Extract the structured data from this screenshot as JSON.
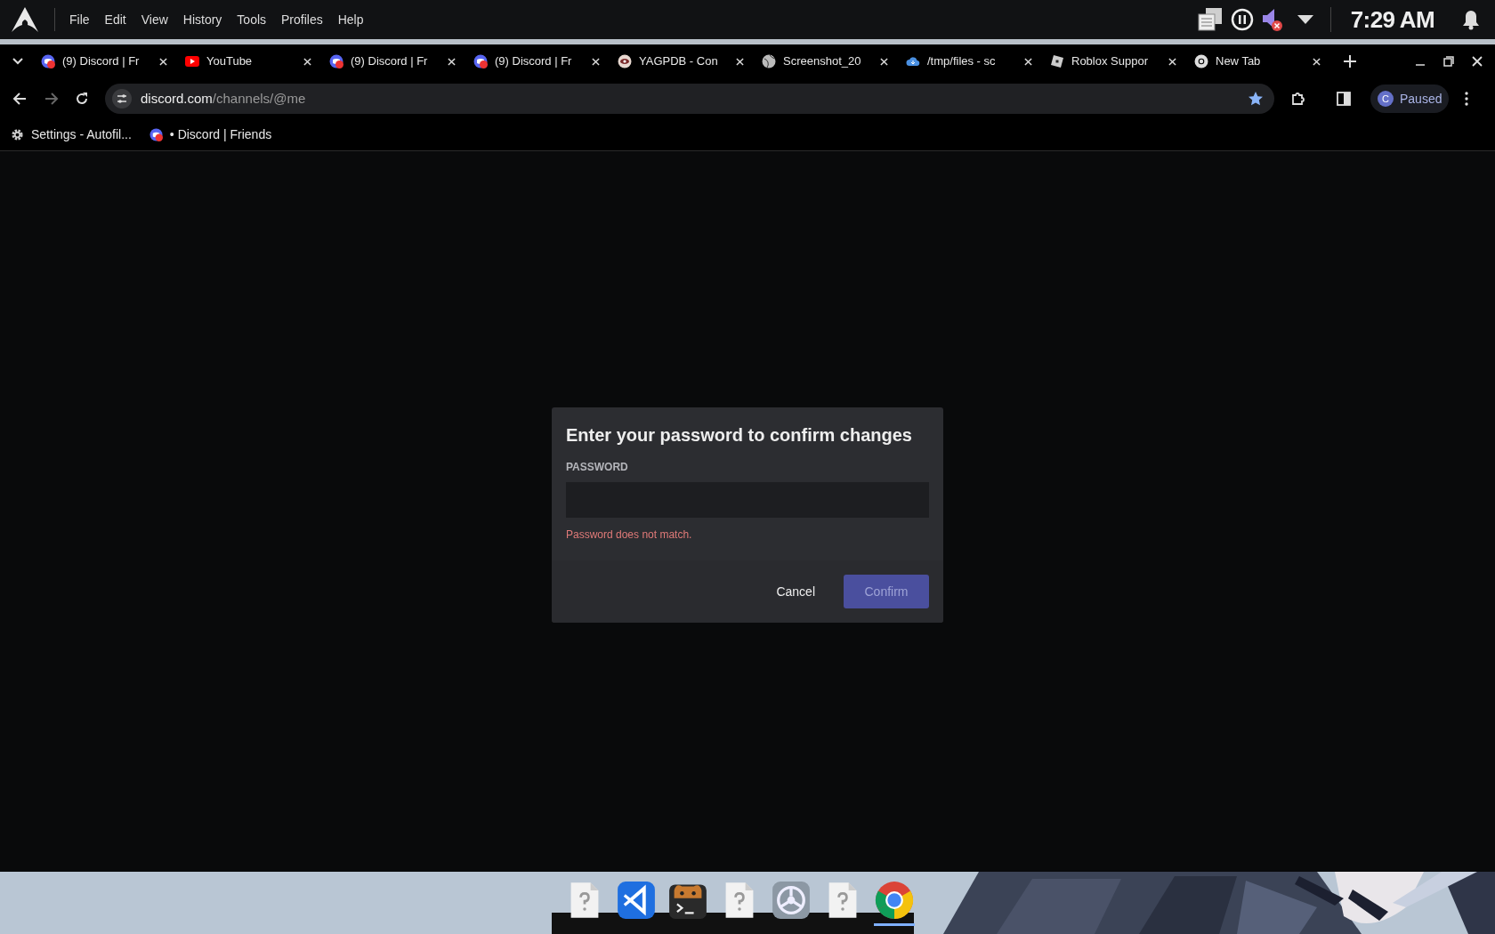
{
  "top_bar": {
    "menus": [
      "File",
      "Edit",
      "View",
      "History",
      "Tools",
      "Profiles",
      "Help"
    ],
    "clock": "7:29 AM"
  },
  "tabs": [
    {
      "title": "(9) Discord | Fr",
      "kind": "discord"
    },
    {
      "title": "YouTube",
      "kind": "youtube"
    },
    {
      "title": "(9) Discord | Fr",
      "kind": "discord"
    },
    {
      "title": "(9) Discord | Fr",
      "kind": "discord"
    },
    {
      "title": "YAGPDB - Con",
      "kind": "eye"
    },
    {
      "title": "Screenshot_20",
      "kind": "globe"
    },
    {
      "title": "/tmp/files - sc",
      "kind": "cloud"
    },
    {
      "title": "Roblox Suppor",
      "kind": "square"
    },
    {
      "title": "New Tab",
      "kind": "chrome"
    }
  ],
  "address_bar": {
    "domain": "discord.com",
    "path": "/channels/@me"
  },
  "profile": {
    "initial": "C",
    "status": "Paused"
  },
  "bookmarks": [
    {
      "label": "Settings - Autofil...",
      "kind": "gear"
    },
    {
      "label": "• Discord | Friends",
      "kind": "discord"
    }
  ],
  "dialog": {
    "title": "Enter your password to confirm changes",
    "field_label": "PASSWORD",
    "error": "Password does not match.",
    "cancel": "Cancel",
    "confirm": {
      "label": "Confirm",
      "disabled": true
    }
  },
  "dock": [
    {
      "kind": "file",
      "active": false
    },
    {
      "kind": "editor",
      "active": false
    },
    {
      "kind": "terminal",
      "active": false
    },
    {
      "kind": "file",
      "active": false
    },
    {
      "kind": "settings",
      "active": false
    },
    {
      "kind": "file",
      "active": false
    },
    {
      "kind": "browser",
      "active": true
    }
  ]
}
